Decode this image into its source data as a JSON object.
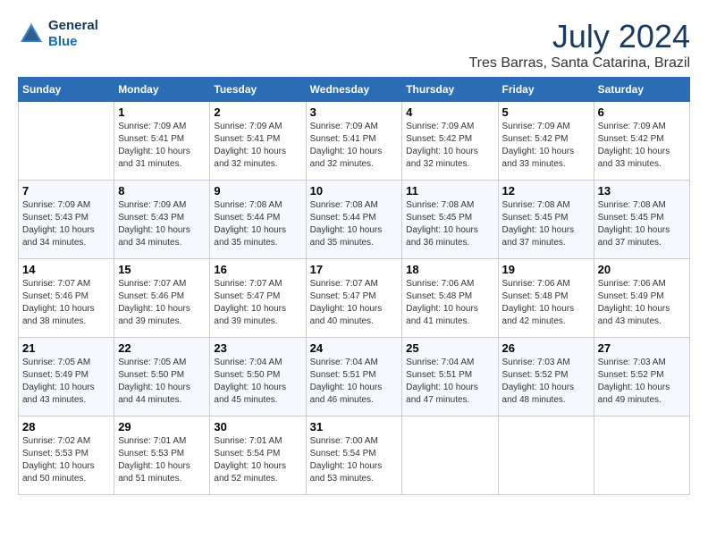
{
  "header": {
    "logo_line1": "General",
    "logo_line2": "Blue",
    "month": "July 2024",
    "location": "Tres Barras, Santa Catarina, Brazil"
  },
  "days_of_week": [
    "Sunday",
    "Monday",
    "Tuesday",
    "Wednesday",
    "Thursday",
    "Friday",
    "Saturday"
  ],
  "weeks": [
    [
      {
        "day": "",
        "info": ""
      },
      {
        "day": "1",
        "info": "Sunrise: 7:09 AM\nSunset: 5:41 PM\nDaylight: 10 hours\nand 31 minutes."
      },
      {
        "day": "2",
        "info": "Sunrise: 7:09 AM\nSunset: 5:41 PM\nDaylight: 10 hours\nand 32 minutes."
      },
      {
        "day": "3",
        "info": "Sunrise: 7:09 AM\nSunset: 5:41 PM\nDaylight: 10 hours\nand 32 minutes."
      },
      {
        "day": "4",
        "info": "Sunrise: 7:09 AM\nSunset: 5:42 PM\nDaylight: 10 hours\nand 32 minutes."
      },
      {
        "day": "5",
        "info": "Sunrise: 7:09 AM\nSunset: 5:42 PM\nDaylight: 10 hours\nand 33 minutes."
      },
      {
        "day": "6",
        "info": "Sunrise: 7:09 AM\nSunset: 5:42 PM\nDaylight: 10 hours\nand 33 minutes."
      }
    ],
    [
      {
        "day": "7",
        "info": "Sunrise: 7:09 AM\nSunset: 5:43 PM\nDaylight: 10 hours\nand 34 minutes."
      },
      {
        "day": "8",
        "info": "Sunrise: 7:09 AM\nSunset: 5:43 PM\nDaylight: 10 hours\nand 34 minutes."
      },
      {
        "day": "9",
        "info": "Sunrise: 7:08 AM\nSunset: 5:44 PM\nDaylight: 10 hours\nand 35 minutes."
      },
      {
        "day": "10",
        "info": "Sunrise: 7:08 AM\nSunset: 5:44 PM\nDaylight: 10 hours\nand 35 minutes."
      },
      {
        "day": "11",
        "info": "Sunrise: 7:08 AM\nSunset: 5:45 PM\nDaylight: 10 hours\nand 36 minutes."
      },
      {
        "day": "12",
        "info": "Sunrise: 7:08 AM\nSunset: 5:45 PM\nDaylight: 10 hours\nand 37 minutes."
      },
      {
        "day": "13",
        "info": "Sunrise: 7:08 AM\nSunset: 5:45 PM\nDaylight: 10 hours\nand 37 minutes."
      }
    ],
    [
      {
        "day": "14",
        "info": "Sunrise: 7:07 AM\nSunset: 5:46 PM\nDaylight: 10 hours\nand 38 minutes."
      },
      {
        "day": "15",
        "info": "Sunrise: 7:07 AM\nSunset: 5:46 PM\nDaylight: 10 hours\nand 39 minutes."
      },
      {
        "day": "16",
        "info": "Sunrise: 7:07 AM\nSunset: 5:47 PM\nDaylight: 10 hours\nand 39 minutes."
      },
      {
        "day": "17",
        "info": "Sunrise: 7:07 AM\nSunset: 5:47 PM\nDaylight: 10 hours\nand 40 minutes."
      },
      {
        "day": "18",
        "info": "Sunrise: 7:06 AM\nSunset: 5:48 PM\nDaylight: 10 hours\nand 41 minutes."
      },
      {
        "day": "19",
        "info": "Sunrise: 7:06 AM\nSunset: 5:48 PM\nDaylight: 10 hours\nand 42 minutes."
      },
      {
        "day": "20",
        "info": "Sunrise: 7:06 AM\nSunset: 5:49 PM\nDaylight: 10 hours\nand 43 minutes."
      }
    ],
    [
      {
        "day": "21",
        "info": "Sunrise: 7:05 AM\nSunset: 5:49 PM\nDaylight: 10 hours\nand 43 minutes."
      },
      {
        "day": "22",
        "info": "Sunrise: 7:05 AM\nSunset: 5:50 PM\nDaylight: 10 hours\nand 44 minutes."
      },
      {
        "day": "23",
        "info": "Sunrise: 7:04 AM\nSunset: 5:50 PM\nDaylight: 10 hours\nand 45 minutes."
      },
      {
        "day": "24",
        "info": "Sunrise: 7:04 AM\nSunset: 5:51 PM\nDaylight: 10 hours\nand 46 minutes."
      },
      {
        "day": "25",
        "info": "Sunrise: 7:04 AM\nSunset: 5:51 PM\nDaylight: 10 hours\nand 47 minutes."
      },
      {
        "day": "26",
        "info": "Sunrise: 7:03 AM\nSunset: 5:52 PM\nDaylight: 10 hours\nand 48 minutes."
      },
      {
        "day": "27",
        "info": "Sunrise: 7:03 AM\nSunset: 5:52 PM\nDaylight: 10 hours\nand 49 minutes."
      }
    ],
    [
      {
        "day": "28",
        "info": "Sunrise: 7:02 AM\nSunset: 5:53 PM\nDaylight: 10 hours\nand 50 minutes."
      },
      {
        "day": "29",
        "info": "Sunrise: 7:01 AM\nSunset: 5:53 PM\nDaylight: 10 hours\nand 51 minutes."
      },
      {
        "day": "30",
        "info": "Sunrise: 7:01 AM\nSunset: 5:54 PM\nDaylight: 10 hours\nand 52 minutes."
      },
      {
        "day": "31",
        "info": "Sunrise: 7:00 AM\nSunset: 5:54 PM\nDaylight: 10 hours\nand 53 minutes."
      },
      {
        "day": "",
        "info": ""
      },
      {
        "day": "",
        "info": ""
      },
      {
        "day": "",
        "info": ""
      }
    ]
  ]
}
